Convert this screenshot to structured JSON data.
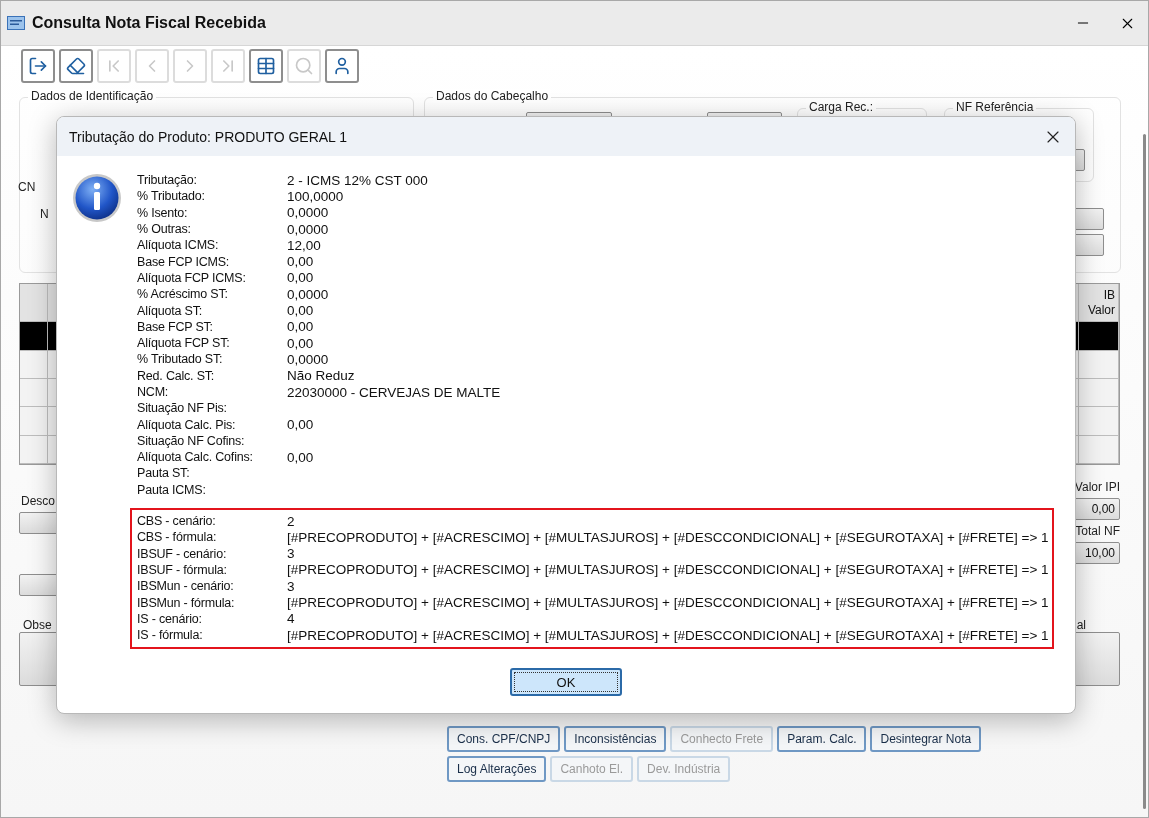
{
  "window": {
    "title": "Consulta Nota Fiscal Recebida"
  },
  "toolbar": [
    {
      "kind": "exit",
      "disabled": false
    },
    {
      "kind": "eraser",
      "disabled": false
    },
    {
      "kind": "first",
      "disabled": true
    },
    {
      "kind": "previous",
      "disabled": true
    },
    {
      "kind": "next",
      "disabled": true
    },
    {
      "kind": "last",
      "disabled": true
    },
    {
      "kind": "table",
      "disabled": false
    },
    {
      "kind": "search",
      "disabled": true
    },
    {
      "kind": "user",
      "disabled": false
    }
  ],
  "identification": {
    "title": "Dados de Identificação",
    "labels": [
      "CN",
      "N"
    ]
  },
  "header": {
    "title": "Dados do Cabeçalho",
    "carga_label": "Carga Rec.:",
    "reference_title": "NF Referência"
  },
  "items_table": {
    "columns": [
      "IB Valor"
    ],
    "rows": [
      {
        "selected": true
      },
      {
        "selected": false
      },
      {
        "selected": false
      },
      {
        "selected": false
      },
      {
        "selected": false
      }
    ]
  },
  "totals": {
    "discount_label": "Desco",
    "ipi_label": "Valor IPI",
    "ipi_value": "0,00",
    "total_label": "Total NF",
    "total_value": "10,00",
    "notes_label": "Obse",
    "side_label": "al"
  },
  "actions": [
    [
      {
        "label": "Cons. CPF/CNPJ",
        "disabled": false
      },
      {
        "label": "Inconsistências",
        "disabled": false
      },
      {
        "label": "Conhecto Frete",
        "disabled": true
      },
      {
        "label": "Param. Calc.",
        "disabled": false
      },
      {
        "label": "Desintegrar Nota",
        "disabled": false
      }
    ],
    [
      {
        "label": "Log Alterações",
        "disabled": false
      },
      {
        "label": "Canhoto El.",
        "disabled": true
      },
      {
        "label": "Dev. Indústria",
        "disabled": true
      }
    ]
  ],
  "dialog": {
    "title": "Tributação do Produto: PRODUTO GERAL 1",
    "rows": [
      {
        "label": "Tributação:",
        "value": "2 - ICMS 12% CST 000"
      },
      {
        "label": "% Tributado:",
        "value": "100,0000"
      },
      {
        "label": "% Isento:",
        "value": "0,0000"
      },
      {
        "label": "% Outras:",
        "value": "0,0000"
      },
      {
        "label": "Alíquota ICMS:",
        "value": "12,00"
      },
      {
        "label": "Base FCP ICMS:",
        "value": "0,00"
      },
      {
        "label": "Alíquota FCP ICMS:",
        "value": "0,00"
      },
      {
        "label": "% Acréscimo ST:",
        "value": "0,0000"
      },
      {
        "label": "Alíquota ST:",
        "value": "0,00"
      },
      {
        "label": "Base FCP ST:",
        "value": "0,00"
      },
      {
        "label": "Alíquota FCP ST:",
        "value": "0,00"
      },
      {
        "label": "% Tributado ST:",
        "value": "0,0000"
      },
      {
        "label": "Red. Calc. ST:",
        "value": "Não Reduz"
      },
      {
        "label": "NCM:",
        "value": "22030000 - CERVEJAS DE MALTE"
      },
      {
        "label": "Situação NF Pis:",
        "value": ""
      },
      {
        "label": "Alíquota Calc. Pis:",
        "value": "0,00"
      },
      {
        "label": "Situação NF Cofins:",
        "value": ""
      },
      {
        "label": "Alíquota Calc. Cofins:",
        "value": "0,00"
      },
      {
        "label": "Pauta ST:",
        "value": ""
      },
      {
        "label": "Pauta ICMS:",
        "value": ""
      }
    ],
    "highlighted_rows": [
      {
        "label": "CBS - cenário:",
        "value": "2"
      },
      {
        "label": "CBS - fórmula:",
        "value": "[#PRECOPRODUTO] + [#ACRESCIMO] + [#MULTASJUROS] + [#DESCCONDICIONAL] + [#SEGUROTAXA] + [#FRETE] => 1"
      },
      {
        "label": "IBSUF - cenário:",
        "value": "3"
      },
      {
        "label": "IBSUF - fórmula:",
        "value": "[#PRECOPRODUTO] + [#ACRESCIMO] + [#MULTASJUROS] + [#DESCCONDICIONAL] + [#SEGUROTAXA] + [#FRETE] => 1"
      },
      {
        "label": "IBSMun - cenário:",
        "value": "3"
      },
      {
        "label": "IBSMun - fórmula:",
        "value": "[#PRECOPRODUTO] + [#ACRESCIMO] + [#MULTASJUROS] + [#DESCCONDICIONAL] + [#SEGUROTAXA] + [#FRETE] => 1"
      },
      {
        "label": "IS - cenário:",
        "value": "4"
      },
      {
        "label": "IS - fórmula:",
        "value": "[#PRECOPRODUTO] + [#ACRESCIMO] + [#MULTASJUROS] + [#DESCCONDICIONAL] + [#SEGUROTAXA] + [#FRETE] => 1"
      }
    ],
    "ok_button": "OK"
  }
}
